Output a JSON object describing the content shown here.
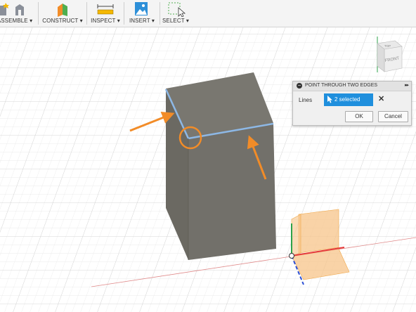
{
  "toolbar": {
    "groups": [
      {
        "label": "ASSEMBLE ▾"
      },
      {
        "label": "CONSTRUCT ▾"
      },
      {
        "label": "INSPECT ▾"
      },
      {
        "label": "INSERT ▾"
      },
      {
        "label": "SELECT ▾"
      }
    ]
  },
  "viewcube": {
    "top": "TOP",
    "front": "FRONT"
  },
  "dialog": {
    "title": "POINT THROUGH TWO EDGES",
    "field_label": "Lines",
    "selection": "2 selected",
    "clear_symbol": "✕",
    "ok_label": "OK",
    "cancel_label": "Cancel"
  },
  "colors": {
    "accent_blue": "#1f8fdd",
    "annotation_orange": "#f28c28",
    "box_gray": "#6e6c66",
    "edge_highlight": "#8db8e6"
  }
}
